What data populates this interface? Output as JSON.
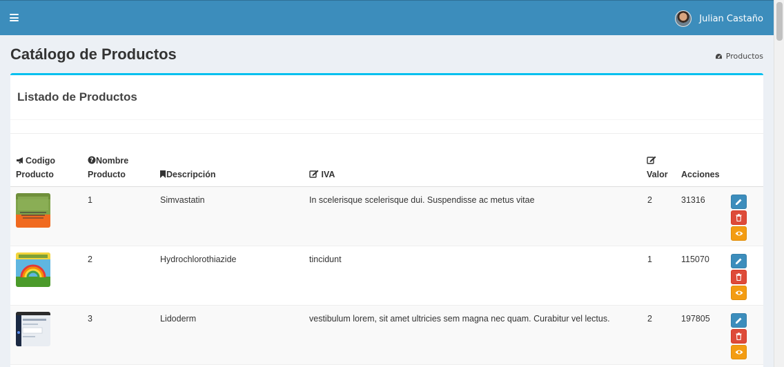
{
  "header": {
    "user_name": "Julian Castaño"
  },
  "page": {
    "title": "Catálogo de Productos",
    "breadcrumb": "Productos"
  },
  "box": {
    "title": "Listado de Productos"
  },
  "table": {
    "headers": {
      "codigo_line1": "Codigo",
      "codigo_line2": "Producto",
      "nombre_line1": "Nombre",
      "nombre_line2": "Producto",
      "descripcion": "Descripción",
      "iva": "IVA",
      "valor": "Valor",
      "acciones": "Acciones"
    },
    "rows": [
      {
        "codigo": "1",
        "nombre": "Simvastatin",
        "descripcion": "In scelerisque scelerisque dui. Suspendisse ac metus vitae",
        "iva": "2",
        "valor": "31316"
      },
      {
        "codigo": "2",
        "nombre": "Hydrochlorothiazide",
        "descripcion": "tincidunt",
        "iva": "1",
        "valor": "115070"
      },
      {
        "codigo": "3",
        "nombre": "Lidoderm",
        "descripcion": "vestibulum lorem, sit amet ultricies sem magna nec quam. Curabitur vel lectus.",
        "iva": "2",
        "valor": "197805"
      }
    ]
  },
  "icons": {
    "menu": "hamburger-icon",
    "breadcrumb": "dashboard-icon",
    "codigo": "bullhorn-icon",
    "nombre": "question-circle-icon",
    "descripcion": "bookmark-icon",
    "iva": "edit-icon",
    "valor": "edit-icon",
    "edit_button": "pencil-icon",
    "delete_button": "trash-icon",
    "view_button": "eye-icon"
  },
  "colors": {
    "header": "#3c8dbc",
    "box_accent": "#00c0ef",
    "edit": "#3c8dbc",
    "delete": "#dd4b39",
    "view": "#f39c12"
  }
}
